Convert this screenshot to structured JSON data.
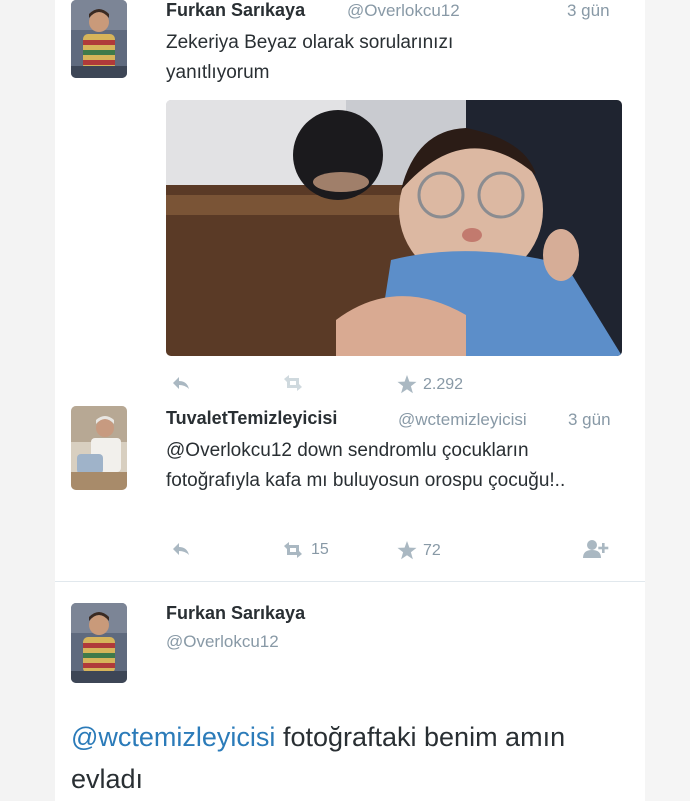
{
  "tweet1": {
    "name": "Furkan Sarıkaya",
    "handle": "@Overlokcu12",
    "time": "3 gün",
    "text": "Zekeriya Beyaz olarak sorularınızı yanıtlıyorum",
    "stats": {
      "retweets": "",
      "likes": "2.292"
    }
  },
  "tweet2": {
    "name": "TuvaletTemizleyicisi",
    "handle": "@wctemizleyicisi",
    "time": "3 gün",
    "text": "@Overlokcu12 down sendromlu çocukların fotoğrafıyla kafa mı buluyosun orospu çocuğu!..",
    "stats": {
      "retweets": "15",
      "likes": "72"
    }
  },
  "tweet3": {
    "name": "Furkan Sarıkaya",
    "handle": "@Overlokcu12",
    "mention": "@wctemizleyicisi",
    "text": " fotoğraftaki benim amın evladı"
  },
  "colors": {
    "link": "#2b7bb9",
    "muted": "#8899a6",
    "text": "#292f33",
    "divider": "#e1e8ed"
  },
  "icons": [
    "reply-icon",
    "retweet-icon",
    "star-icon",
    "follow-icon"
  ]
}
